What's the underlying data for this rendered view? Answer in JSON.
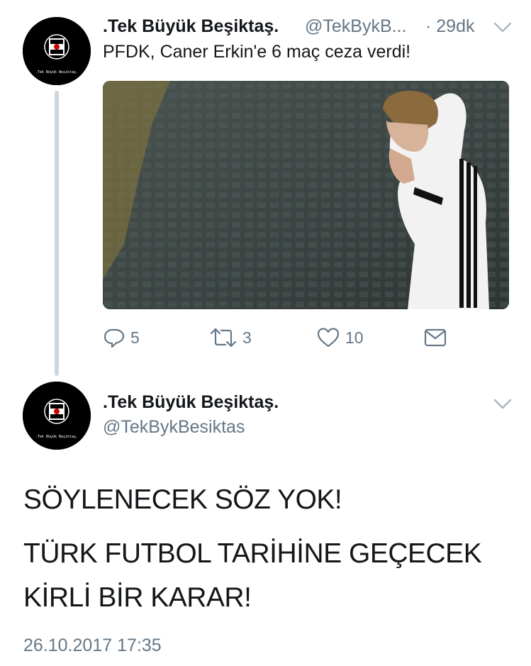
{
  "reply_to_tweet": {
    "display_name": ".Tek Büyük Beşiktaş.",
    "handle": "@TekBykB...",
    "time": "· 29dk",
    "text": "PFDK, Caner Erkin'e 6 maç ceza verdi!",
    "avatar_text": ".Tek Büyük Beşiktaş.",
    "avatar_badge": "BJK 1903",
    "actions": {
      "reply_count": "5",
      "retweet_count": "3",
      "like_count": "10"
    }
  },
  "main_tweet": {
    "display_name": ".Tek Büyük Beşiktaş.",
    "handle": "@TekBykBesiktas",
    "avatar_text": ".Tek Büyük Beşiktaş.",
    "avatar_badge": "BJK 1903",
    "text_line1": "SÖYLENECEK SÖZ YOK!",
    "text_line2": "TÜRK FUTBOL TARİHİNE GEÇECEK",
    "text_line3": "KİRLİ BİR KARAR!",
    "timestamp": "26.10.2017 17:35"
  },
  "colors": {
    "text_primary": "#14171a",
    "text_secondary": "#657786",
    "thread_line": "#ccd6dd"
  },
  "icons": [
    "reply-icon",
    "retweet-icon",
    "like-icon",
    "direct-message-icon",
    "chevron-down-icon"
  ]
}
